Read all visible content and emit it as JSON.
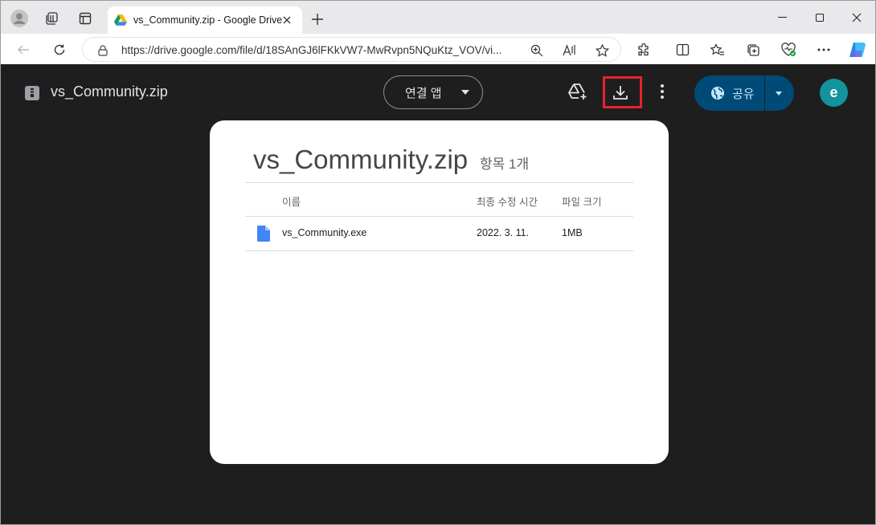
{
  "browser": {
    "tab_title": "vs_Community.zip - Google Drive",
    "url": "https://drive.google.com/file/d/18SAnGJ6lFKkVW7-MwRvpn5NQuKtz_VOV/vi..."
  },
  "drive": {
    "file_title": "vs_Community.zip",
    "connect_apps_label": "연결 앱",
    "share_label": "공유",
    "avatar_letter": "e",
    "highlight_color": "#e8222b"
  },
  "card": {
    "title": "vs_Community.zip",
    "item_count": "항목 1개",
    "columns": {
      "name": "이름",
      "modified": "최종 수정 시간",
      "size": "파일 크기"
    },
    "rows": [
      {
        "name": "vs_Community.exe",
        "modified": "2022. 3. 11.",
        "size": "1MB"
      }
    ]
  },
  "icons": [
    "profile-icon",
    "workspaces-icon",
    "tab-actions-icon",
    "google-drive-icon",
    "close-icon",
    "plus-icon",
    "minimize-icon",
    "maximize-icon",
    "back-icon",
    "refresh-icon",
    "lock-icon",
    "zoom-icon",
    "read-aloud-icon",
    "favorite-icon",
    "extensions-icon",
    "split-screen-icon",
    "favorites-icon",
    "collections-icon",
    "browser-essentials-icon",
    "more-icon",
    "copilot-icon",
    "zip-file-icon",
    "add-to-drive-icon",
    "download-icon",
    "more-vert-icon",
    "globe-icon",
    "doc-file-icon"
  ]
}
